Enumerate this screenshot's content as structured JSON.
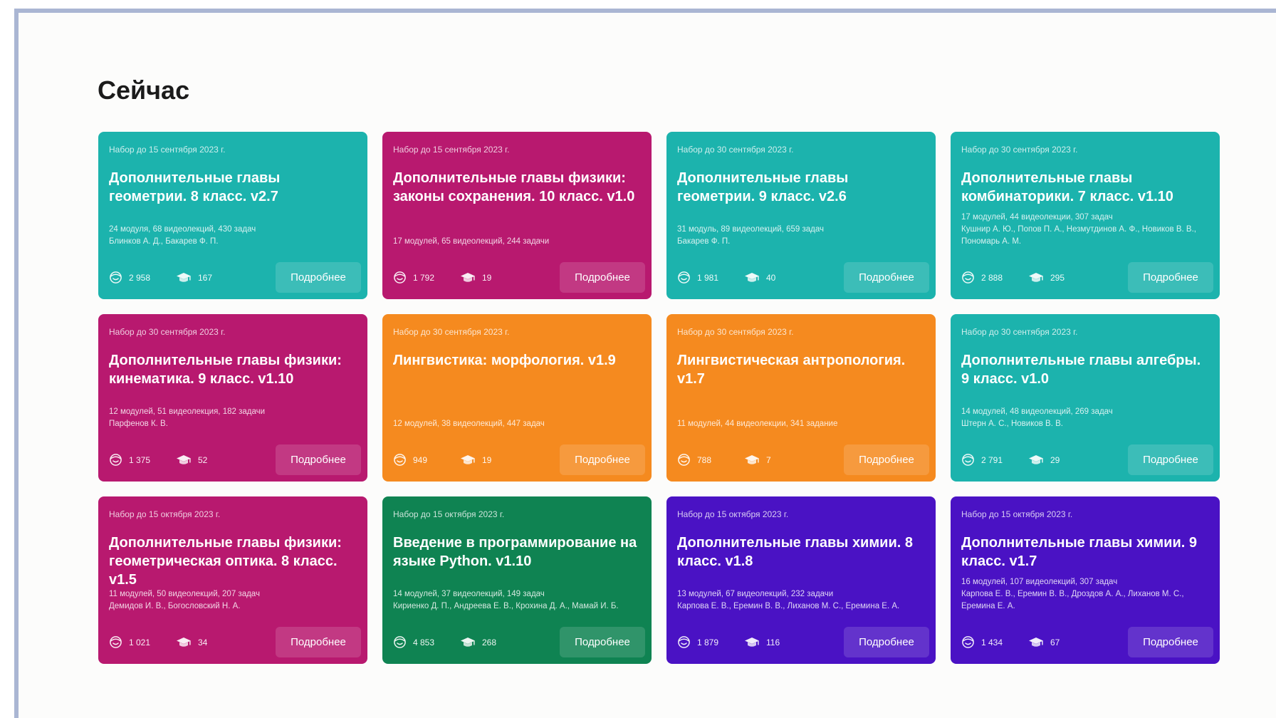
{
  "section_title": "Сейчас",
  "colors": {
    "teal": "#1cb3ad",
    "magenta": "#b8196f",
    "orange": "#f58a1f",
    "green": "#0f8352",
    "purple": "#4a12c4"
  },
  "cards": [
    {
      "color": "#1cb3ad",
      "enroll": "Набор до 15 сентября 2023 г.",
      "title": "Дополнительные главы геометрии. 8 класс. v2.7",
      "stats_line": "24 модуля, 68 видеолекций, 430 задач",
      "authors": "Блинков А. Д., Бакарев Ф. П.",
      "views": "2 958",
      "graduates": "167",
      "button": "Подробнее"
    },
    {
      "color": "#b8196f",
      "enroll": "Набор до 15 сентября 2023 г.",
      "title": "Дополнительные главы физики: законы сохранения. 10 класс. v1.0",
      "stats_line": "17 модулей, 65 видеолекций, 244 задачи",
      "authors": "",
      "views": "1 792",
      "graduates": "19",
      "button": "Подробнее"
    },
    {
      "color": "#1cb3ad",
      "enroll": "Набор до 30 сентября 2023 г.",
      "title": "Дополнительные главы геометрии. 9 класс. v2.6",
      "stats_line": "31 модуль, 89 видеолекций, 659 задач",
      "authors": "Бакарев Ф. П.",
      "views": "1 981",
      "graduates": "40",
      "button": "Подробнее"
    },
    {
      "color": "#1cb3ad",
      "enroll": "Набор до 30 сентября 2023 г.",
      "title": "Дополнительные главы комбинаторики. 7 класс. v1.10",
      "stats_line": "17 модулей, 44 видеолекции, 307 задач",
      "authors": "Кушнир А. Ю., Попов П. А., Незмутдинов А. Ф., Новиков В. В., Пономарь А. М.",
      "views": "2 888",
      "graduates": "295",
      "button": "Подробнее"
    },
    {
      "color": "#b8196f",
      "enroll": "Набор до 30 сентября 2023 г.",
      "title": "Дополнительные главы физики: кинематика. 9 класс. v1.10",
      "stats_line": "12 модулей, 51 видеолекция, 182 задачи",
      "authors": "Парфенов К. В.",
      "views": "1 375",
      "graduates": "52",
      "button": "Подробнее"
    },
    {
      "color": "#f58a1f",
      "enroll": "Набор до 30 сентября 2023 г.",
      "title": "Лингвистика: морфология. v1.9",
      "stats_line": "12 модулей, 38 видеолекций, 447 задач",
      "authors": "",
      "views": "949",
      "graduates": "19",
      "button": "Подробнее"
    },
    {
      "color": "#f58a1f",
      "enroll": "Набор до 30 сентября 2023 г.",
      "title": "Лингвистическая антропология. v1.7",
      "stats_line": "11 модулей, 44 видеолекции, 341 задание",
      "authors": "",
      "views": "788",
      "graduates": "7",
      "button": "Подробнее"
    },
    {
      "color": "#1cb3ad",
      "enroll": "Набор до 30 сентября 2023 г.",
      "title": "Дополнительные главы алгебры. 9 класс. v1.0",
      "stats_line": "14 модулей, 48 видеолекций, 269 задач",
      "authors": "Штерн А. С., Новиков В. В.",
      "views": "2 791",
      "graduates": "29",
      "button": "Подробнее"
    },
    {
      "color": "#b8196f",
      "enroll": "Набор до 15 октября 2023 г.",
      "title": "Дополнительные главы физики: геометрическая оптика. 8 класс. v1.5",
      "stats_line": "11 модулей, 50 видеолекций, 207 задач",
      "authors": "Демидов И. В., Богословский Н. А.",
      "views": "1 021",
      "graduates": "34",
      "button": "Подробнее"
    },
    {
      "color": "#0f8352",
      "enroll": "Набор до 15 октября 2023 г.",
      "title": "Введение в программирование на языке Python. v1.10",
      "stats_line": "14 модулей, 37 видеолекций, 149 задач",
      "authors": "Кириенко Д. П., Андреева Е. В., Крохина Д. А., Мамай И. Б.",
      "views": "4 853",
      "graduates": "268",
      "button": "Подробнее"
    },
    {
      "color": "#4a12c4",
      "enroll": "Набор до 15 октября 2023 г.",
      "title": "Дополнительные главы химии. 8 класс. v1.8",
      "stats_line": "13 модулей, 67 видеолекций, 232 задачи",
      "authors": "Карпова Е. В., Еремин В. В., Лиханов М. С., Еремина Е. А.",
      "views": "1 879",
      "graduates": "116",
      "button": "Подробнее"
    },
    {
      "color": "#4a12c4",
      "enroll": "Набор до 15 октября 2023 г.",
      "title": "Дополнительные главы химии. 9 класс. v1.7",
      "stats_line": "16 модулей, 107 видеолекций, 307 задач",
      "authors": "Карпова Е. В., Еремин В. В., Дроздов А. А., Лиханов М. С., Еремина Е. А.",
      "views": "1 434",
      "graduates": "67",
      "button": "Подробнее"
    }
  ]
}
